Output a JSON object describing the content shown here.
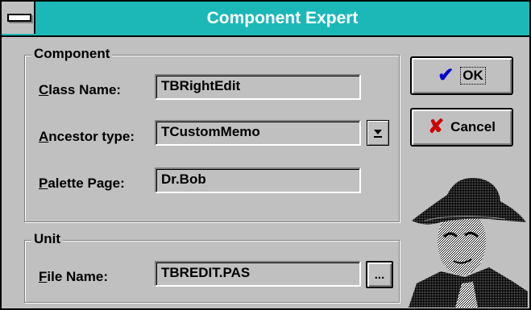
{
  "window": {
    "title": "Component Expert"
  },
  "component_group": {
    "legend": "Component",
    "class_name": {
      "mnemonic": "C",
      "label_rest": "lass Name:",
      "value": "TBRightEdit"
    },
    "ancestor_type": {
      "mnemonic": "A",
      "label_rest": "ncestor type:",
      "value": "TCustomMemo"
    },
    "palette_page": {
      "mnemonic": "P",
      "label_rest": "alette Page:",
      "value": "Dr.Bob"
    }
  },
  "unit_group": {
    "legend": "Unit",
    "file_name": {
      "mnemonic": "F",
      "label_rest": "ile Name:",
      "value": "TBREDIT.PAS",
      "browse_label": "..."
    }
  },
  "buttons": {
    "ok_label": "OK",
    "cancel_label": "Cancel"
  },
  "icons": {
    "system_menu": "system-menu-icon",
    "dropdown": "dropdown-arrow-icon",
    "ok": "checkmark-icon",
    "cancel": "x-icon",
    "portrait": "portrait-image"
  },
  "colors": {
    "titlebar": "#1cb8b8",
    "ok_check": "#0000cc",
    "cancel_x": "#cc0000",
    "face": "#c0c0c0"
  }
}
